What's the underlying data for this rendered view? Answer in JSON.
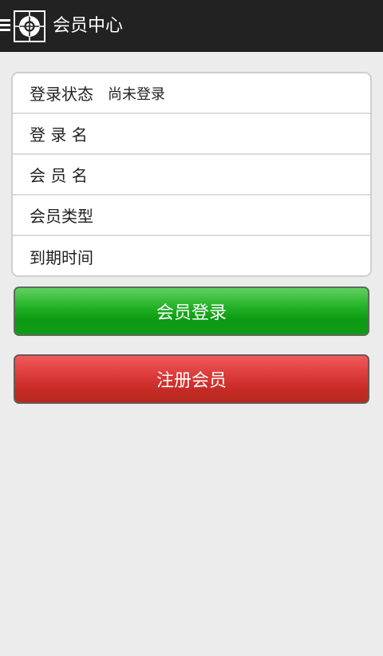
{
  "header": {
    "title": "会员中心",
    "menu_icon": "hamburger-menu-icon",
    "logo_icon": "crosshair-logo-icon"
  },
  "info": {
    "rows": [
      {
        "label": "登录状态",
        "value": "尚未登录"
      },
      {
        "label": "登 录 名",
        "value": ""
      },
      {
        "label": "会 员 名",
        "value": ""
      },
      {
        "label": "会员类型",
        "value": ""
      },
      {
        "label": "到期时间",
        "value": ""
      }
    ]
  },
  "buttons": {
    "login_label": "会员登录",
    "register_label": "注册会员"
  },
  "colors": {
    "appbar_bg": "#222222",
    "page_bg": "#ececec",
    "login_green": "#1fae22",
    "register_red": "#da3838"
  }
}
